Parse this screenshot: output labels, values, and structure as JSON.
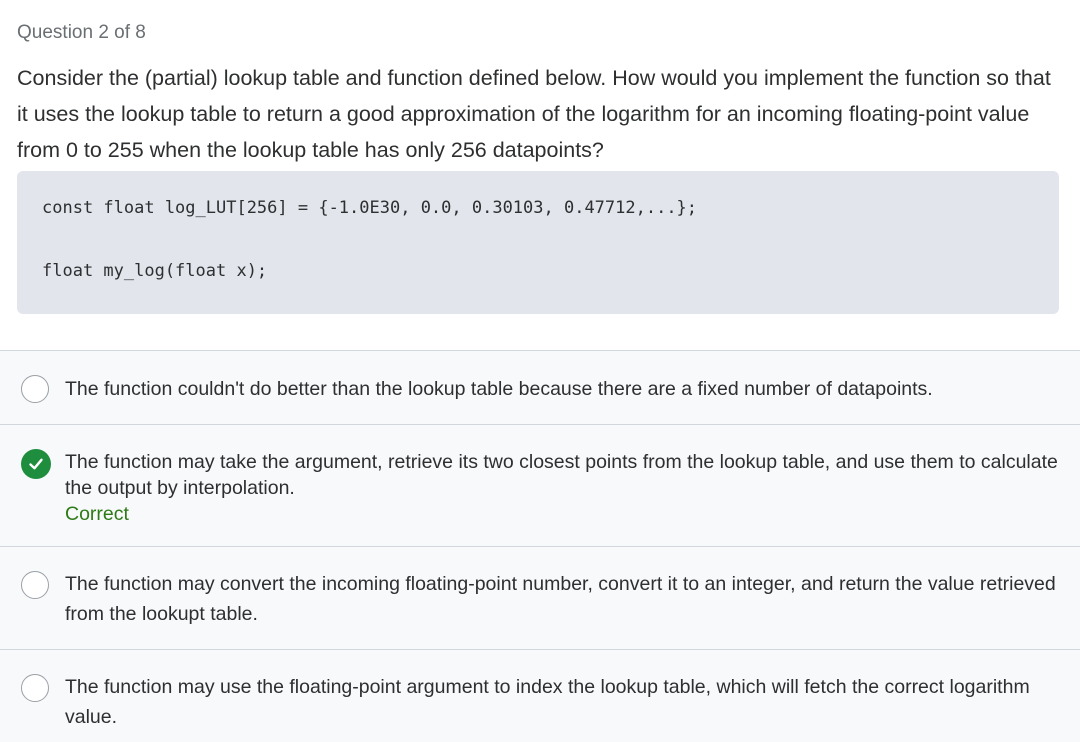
{
  "question": {
    "counter": "Question 2 of 8",
    "prompt": "Consider the (partial) lookup table and function defined below. How would you implement the function so that it uses the lookup table to return a good approximation of the logarithm for an incoming floating-point value from 0 to 255 when the lookup table has only 256 datapoints?",
    "code": {
      "line1": "const float log_LUT[256] = {-1.0E30, 0.0, 0.30103, 0.47712,...};",
      "line2": "float my_log(float x);"
    }
  },
  "answers": [
    {
      "text": "The function couldn't do better than the lookup table because there are a fixed number of datapoints.",
      "selected": false
    },
    {
      "text": "The function may take the argument, retrieve its two closest points from the lookup table, and use them to calculate the output by interpolation.",
      "selected": true,
      "feedback": "Correct"
    },
    {
      "text": "The function may convert the incoming floating-point number, convert it to an integer, and return the value retrieved from the lookupt table.",
      "selected": false
    },
    {
      "text": "The function may use the floating-point argument to index the lookup table, which will fetch the correct logarithm value.",
      "selected": false
    }
  ],
  "colors": {
    "correct": "#1e8e3e",
    "feedback_text": "#2d7a16",
    "code_bg": "#e2e6ec"
  },
  "icons": {
    "correct_marker": "check-circle-icon",
    "unselected_marker": "radio-circle-icon"
  }
}
